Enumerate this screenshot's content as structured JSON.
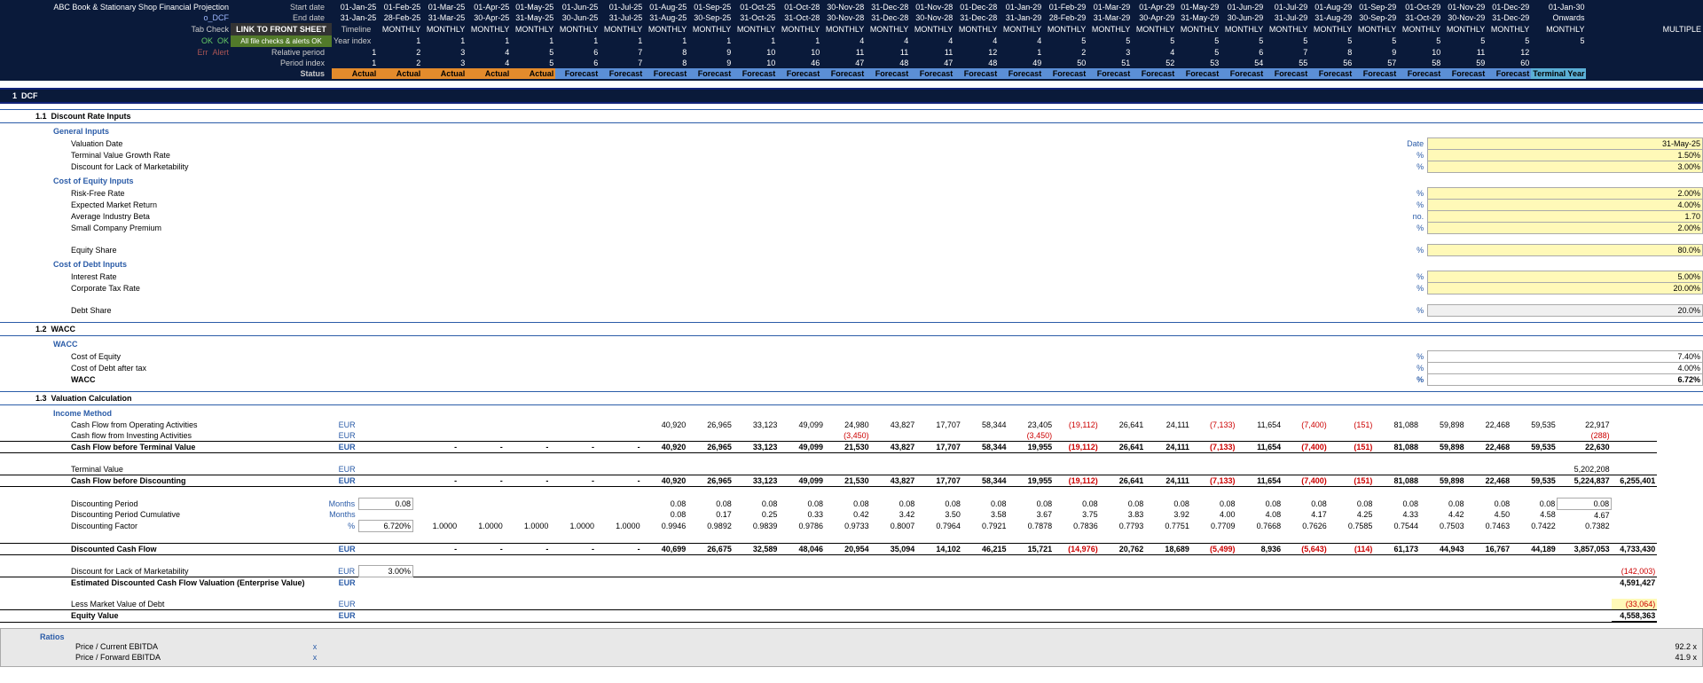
{
  "header": {
    "title": "ABC Book & Stationary Shop Financial Projection",
    "sheet": "o_DCF",
    "link_front": "LINK TO FRONT SHEET",
    "link_sub": "All file checks & alerts OK",
    "tabcheck": "Tab Check",
    "ok": "OK",
    "ok2": "OK",
    "err": "Err",
    "alert": "Alert",
    "rows": [
      {
        "l": "Start date",
        "v": [
          "01-Jan-25",
          "01-Feb-25",
          "01-Mar-25",
          "01-Apr-25",
          "01-May-25",
          "01-Jun-25",
          "01-Jul-25",
          "01-Aug-25",
          "01-Sep-25",
          "01-Oct-25",
          "01-Oct-28",
          "30-Nov-28",
          "31-Dec-28",
          "01-Nov-28",
          "01-Dec-28",
          "01-Jan-29",
          "01-Feb-29",
          "01-Mar-29",
          "01-Apr-29",
          "01-May-29",
          "01-Jun-29",
          "01-Jul-29",
          "01-Aug-29",
          "01-Sep-29",
          "01-Oct-29",
          "01-Nov-29",
          "01-Dec-29",
          "01-Jan-30"
        ]
      },
      {
        "l": "End date",
        "v": [
          "31-Jan-25",
          "28-Feb-25",
          "31-Mar-25",
          "30-Apr-25",
          "31-May-25",
          "30-Jun-25",
          "31-Jul-25",
          "31-Aug-25",
          "30-Sep-25",
          "31-Oct-25",
          "31-Oct-28",
          "30-Nov-28",
          "31-Dec-28",
          "30-Nov-28",
          "31-Dec-28",
          "31-Jan-29",
          "28-Feb-29",
          "31-Mar-29",
          "30-Apr-29",
          "31-May-29",
          "30-Jun-29",
          "31-Jul-29",
          "31-Aug-29",
          "30-Sep-29",
          "31-Oct-29",
          "30-Nov-29",
          "31-Dec-29",
          "Onwards"
        ]
      },
      {
        "l": "Timeline",
        "v": [
          "MONTHLY",
          "MONTHLY",
          "MONTHLY",
          "MONTHLY",
          "MONTHLY",
          "MONTHLY",
          "MONTHLY",
          "MONTHLY",
          "MONTHLY",
          "MONTHLY",
          "MONTHLY",
          "MONTHLY",
          "MONTHLY",
          "MONTHLY",
          "MONTHLY",
          "MONTHLY",
          "MONTHLY",
          "MONTHLY",
          "MONTHLY",
          "MONTHLY",
          "MONTHLY",
          "MONTHLY",
          "MONTHLY",
          "MONTHLY",
          "MONTHLY",
          "MONTHLY",
          "MONTHLY",
          "MULTIPLE"
        ]
      },
      {
        "l": "Year index",
        "v": [
          "1",
          "1",
          "1",
          "1",
          "1",
          "1",
          "1",
          "1",
          "1",
          "1",
          "4",
          "4",
          "4",
          "4",
          "4",
          "5",
          "5",
          "5",
          "5",
          "5",
          "5",
          "5",
          "5",
          "5",
          "5",
          "5",
          "5",
          ""
        ]
      },
      {
        "l": "Relative period",
        "v": [
          "1",
          "2",
          "3",
          "4",
          "5",
          "6",
          "7",
          "8",
          "9",
          "10",
          "10",
          "11",
          "11",
          "11",
          "12",
          "1",
          "2",
          "3",
          "4",
          "5",
          "6",
          "7",
          "8",
          "9",
          "10",
          "11",
          "12",
          ""
        ]
      },
      {
        "l": "Period index",
        "v": [
          "1",
          "2",
          "3",
          "4",
          "5",
          "6",
          "7",
          "8",
          "9",
          "10",
          "46",
          "47",
          "48",
          "47",
          "48",
          "49",
          "50",
          "51",
          "52",
          "53",
          "54",
          "55",
          "56",
          "57",
          "58",
          "59",
          "60",
          ""
        ]
      }
    ],
    "status": {
      "l": "Status",
      "actual": "Actual",
      "forecast": "Forecast",
      "terminal": "Terminal Year",
      "pattern": [
        "a",
        "a",
        "a",
        "a",
        "a",
        "f",
        "f",
        "f",
        "f",
        "f",
        "f",
        "f",
        "f",
        "f",
        "f",
        "f",
        "f",
        "f",
        "f",
        "f",
        "f",
        "f",
        "f",
        "f",
        "f",
        "f",
        "f",
        "t"
      ]
    }
  },
  "s1": {
    "num": "1",
    "title": "DCF"
  },
  "s11": {
    "num": "1.1",
    "title": "Discount Rate Inputs"
  },
  "general": {
    "hd": "General Inputs",
    "valuation_date": {
      "l": "Valuation Date",
      "u": "Date",
      "v": "31-May-25"
    },
    "tv_growth": {
      "l": "Terminal Value Growth Rate",
      "u": "%",
      "v": "1.50%"
    },
    "dlom": {
      "l": "Discount for Lack of Marketability",
      "u": "%",
      "v": "3.00%"
    }
  },
  "coe": {
    "hd": "Cost of Equity Inputs",
    "rfr": {
      "l": "Risk-Free Rate",
      "u": "%",
      "v": "2.00%"
    },
    "emr": {
      "l": "Expected Market Return",
      "u": "%",
      "v": "4.00%"
    },
    "beta": {
      "l": "Average Industry Beta",
      "u": "no.",
      "v": "1.70"
    },
    "scp": {
      "l": "Small Company Premium",
      "u": "%",
      "v": "2.00%"
    },
    "es": {
      "l": "Equity Share",
      "u": "%",
      "v": "80.0%"
    }
  },
  "cod": {
    "hd": "Cost of Debt Inputs",
    "ir": {
      "l": "Interest Rate",
      "u": "%",
      "v": "5.00%"
    },
    "tax": {
      "l": "Corporate Tax Rate",
      "u": "%",
      "v": "20.00%"
    },
    "ds": {
      "l": "Debt Share",
      "u": "%",
      "v": "20.0%"
    }
  },
  "s12": {
    "num": "1.2",
    "title": "WACC"
  },
  "wacc": {
    "hd": "WACC",
    "coe": {
      "l": "Cost of Equity",
      "u": "%",
      "v": "7.40%"
    },
    "codat": {
      "l": "Cost of Debt after tax",
      "u": "%",
      "v": "4.00%"
    },
    "wacc": {
      "l": "WACC",
      "u": "%",
      "v": "6.72%"
    }
  },
  "s13": {
    "num": "1.3",
    "title": "Valuation Calculation"
  },
  "income": {
    "hd": "Income Method",
    "cfo": {
      "l": "Cash Flow from Operating Activities",
      "u": "EUR",
      "v": [
        "",
        "",
        "",
        "",
        "",
        "40,920",
        "26,965",
        "33,123",
        "49,099",
        "24,980",
        "43,827",
        "17,707",
        "58,344",
        "23,405",
        "(19,112)",
        "26,641",
        "24,111",
        "(7,133)",
        "11,654",
        "(7,400)",
        "(151)",
        "81,088",
        "59,898",
        "22,468",
        "59,535",
        "22,917"
      ]
    },
    "cfi": {
      "l": "Cash flow from Investing Activities",
      "u": "EUR",
      "v": [
        "",
        "",
        "",
        "",
        "",
        "",
        "",
        "",
        "",
        "(3,450)",
        "",
        "",
        "",
        "(3,450)",
        "",
        "",
        "",
        "",
        "",
        "",
        "",
        "",
        "",
        "",
        "",
        "(288)"
      ]
    },
    "cfbtv": {
      "l": "Cash Flow before Terminal Value",
      "u": "EUR",
      "v": [
        "-",
        "-",
        "-",
        "-",
        "-",
        "40,920",
        "26,965",
        "33,123",
        "49,099",
        "21,530",
        "43,827",
        "17,707",
        "58,344",
        "19,955",
        "(19,112)",
        "26,641",
        "24,111",
        "(7,133)",
        "11,654",
        "(7,400)",
        "(151)",
        "81,088",
        "59,898",
        "22,468",
        "59,535",
        "22,630"
      ]
    },
    "tv": {
      "l": "Terminal Value",
      "u": "EUR",
      "v": [
        "",
        "",
        "",
        "",
        "",
        "",
        "",
        "",
        "",
        "",
        "",
        "",
        "",
        "",
        "",
        "",
        "",
        "",
        "",
        "",
        "",
        "",
        "",
        "",
        "",
        "5,202,208"
      ]
    },
    "cfbd": {
      "l": "Cash Flow before Discounting",
      "u": "EUR",
      "v": [
        "-",
        "-",
        "-",
        "-",
        "-",
        "40,920",
        "26,965",
        "33,123",
        "49,099",
        "21,530",
        "43,827",
        "17,707",
        "58,344",
        "19,955",
        "(19,112)",
        "26,641",
        "24,111",
        "(7,133)",
        "11,654",
        "(7,400)",
        "(151)",
        "81,088",
        "59,898",
        "22,468",
        "59,535",
        "5,224,837"
      ],
      "end": "6,255,401"
    },
    "dp": {
      "l": "Discounting Period",
      "u": "Months",
      "v": [
        "",
        "",
        "",
        "",
        "",
        "0.08",
        "0.08",
        "0.08",
        "0.08",
        "0.08",
        "0.08",
        "0.08",
        "0.08",
        "0.08",
        "0.08",
        "0.08",
        "0.08",
        "0.08",
        "0.08",
        "0.08",
        "0.08",
        "0.08",
        "0.08",
        "0.08",
        "0.08",
        "0.08"
      ],
      "box": "0.08"
    },
    "dpc": {
      "l": "Discounting Period Cumulative",
      "u": "Months",
      "v": [
        "",
        "",
        "",
        "",
        "",
        "0.08",
        "0.17",
        "0.25",
        "0.33",
        "0.42",
        "3.42",
        "3.50",
        "3.58",
        "3.67",
        "3.75",
        "3.83",
        "3.92",
        "4.00",
        "4.08",
        "4.17",
        "4.25",
        "4.33",
        "4.42",
        "4.50",
        "4.58",
        "4.67"
      ]
    },
    "df": {
      "l": "Discounting Factor",
      "u": "%",
      "box": "6.720%",
      "v": [
        "1.0000",
        "1.0000",
        "1.0000",
        "1.0000",
        "1.0000",
        "0.9946",
        "0.9892",
        "0.9839",
        "0.9786",
        "0.9733",
        "0.8007",
        "0.7964",
        "0.7921",
        "0.7878",
        "0.7836",
        "0.7793",
        "0.7751",
        "0.7709",
        "0.7668",
        "0.7626",
        "0.7585",
        "0.7544",
        "0.7503",
        "0.7463",
        "0.7422",
        "0.7382"
      ]
    },
    "dcf": {
      "l": "Discounted Cash Flow",
      "u": "EUR",
      "v": [
        "-",
        "-",
        "-",
        "-",
        "-",
        "40,699",
        "26,675",
        "32,589",
        "48,046",
        "20,954",
        "35,094",
        "14,102",
        "46,215",
        "15,721",
        "(14,976)",
        "20,762",
        "18,689",
        "(5,499)",
        "8,936",
        "(5,643)",
        "(114)",
        "61,173",
        "44,943",
        "16,767",
        "44,189",
        "3,857,053"
      ],
      "end": "4,733,430"
    },
    "dlom": {
      "l": "Discount for Lack of Marketability",
      "u": "EUR",
      "box": "3.00%",
      "end": "(142,003)"
    },
    "edcf": {
      "l": "Estimated Discounted Cash Flow Valuation (Enterprise Value)",
      "u": "EUR",
      "end": "4,591,427"
    },
    "mvd": {
      "l": "Less Market Value of Debt",
      "u": "EUR",
      "end": "(33,064)"
    },
    "ev": {
      "l": "Equity Value",
      "u": "EUR",
      "end": "4,558,363"
    }
  },
  "ratios": {
    "hd": "Ratios",
    "pce": {
      "l": "Price / Current EBITDA",
      "u": "x",
      "v": "92.2 x"
    },
    "pfe": {
      "l": "Price / Forward EBITDA",
      "u": "x",
      "v": "41.9 x"
    }
  }
}
